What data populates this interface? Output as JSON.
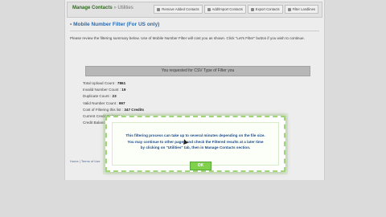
{
  "header": {
    "brand": "Manage Contacts",
    "separator": "»",
    "sub": "Utilities",
    "tabs": [
      {
        "label": "Remove Added Contacts"
      },
      {
        "label": "Add/Import Contacts"
      },
      {
        "label": "Export Contacts"
      },
      {
        "label": "Filter Landlines"
      }
    ]
  },
  "page": {
    "title": "Mobile Number Filter (For US only)",
    "description": "Please review the filtering summary below. Use of Mobile Number Filter will cost you as shown. Click \"Let's Filter\" button if you wish to continue.",
    "banner": "You requested for CSV Type of Filter you",
    "stats": [
      {
        "label": "Total Upload Count :",
        "value": "7861"
      },
      {
        "label": "Invalid Number Count :",
        "value": "19"
      },
      {
        "label": "Duplicate Count :",
        "value": "23"
      },
      {
        "label": "Valid Number Count :",
        "value": "997"
      },
      {
        "label": "Cost of Filtering this list :",
        "value": "347 Credits"
      },
      {
        "label": "Current Credit Balance :",
        "value": ""
      },
      {
        "label": "Credit Balance",
        "value": ""
      }
    ],
    "footer": "Home | Terms of Use"
  },
  "modal": {
    "message_lines": [
      "This filtering process can take up to several minutes depending on the file size.",
      "You may continue to other pages and check the Filtered results at a later time",
      "by clicking on \"Utilities\" tab, then in Manage Contacts section."
    ],
    "ok_label": "OK"
  },
  "colors": {
    "accent_green": "#7fd04b",
    "link_blue": "#2e6fb5"
  }
}
